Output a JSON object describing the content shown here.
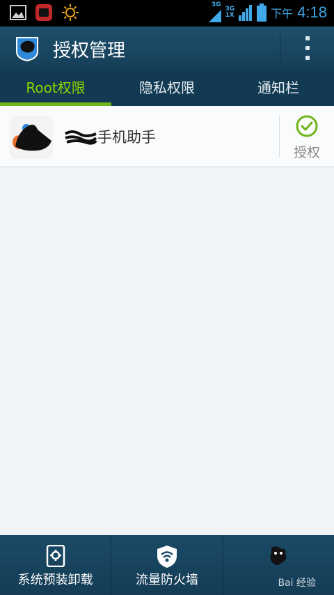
{
  "status_bar": {
    "time": "4:18",
    "ampm": "下午",
    "net1": "3G",
    "net2_top": "3G",
    "net2_bottom": "1X",
    "icons": [
      "image-icon",
      "app-icon",
      "sun-icon",
      "signal-icon",
      "battery-icon"
    ]
  },
  "app_bar": {
    "title": "授权管理",
    "menu_icon": "overflow-menu-icon"
  },
  "tabs": [
    {
      "label": "Root权限",
      "active": true
    },
    {
      "label": "隐私权限",
      "active": false
    },
    {
      "label": "通知栏",
      "active": false
    }
  ],
  "apps": [
    {
      "name": "手机助手",
      "status_label": "授权",
      "status_icon": "check-circle-icon"
    }
  ],
  "bottom_bar": {
    "items": [
      {
        "label": "系统预装卸载",
        "icon": "phone-settings-icon"
      },
      {
        "label": "流量防火墙",
        "icon": "shield-wifi-icon"
      },
      {
        "label": "",
        "icon": "more-icon"
      }
    ],
    "watermark": "Bai 经验"
  },
  "colors": {
    "accent_green": "#8fd400",
    "app_bar": "#1d4f6c",
    "tab_bar": "#123a52",
    "status_blue": "#3fa9e9"
  }
}
